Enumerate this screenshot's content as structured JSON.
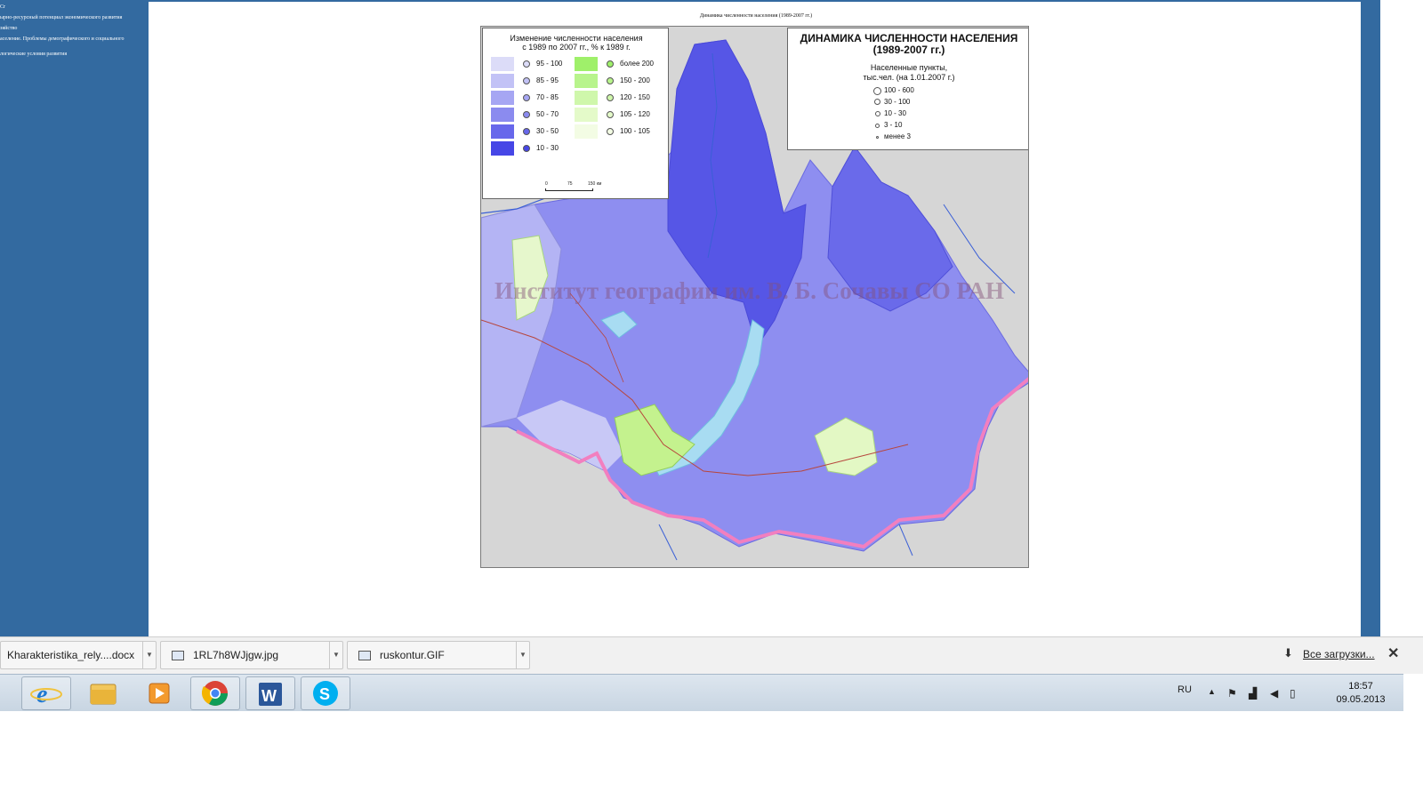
{
  "sidebar": {
    "links": [
      "Cr",
      "ырно-ресурсный потенциал экономического развития",
      "зяйство",
      "аселение. Проблемы демографического и социального",
      "логические условия развития"
    ]
  },
  "document": {
    "title": "Динамика численности населения (1989-2007 гг.)"
  },
  "map": {
    "legend_change": {
      "title_line1": "Изменение численности населения",
      "title_line2": "с 1989 по 2007 гг., % к 1989 г.",
      "decrease": [
        {
          "label": "95 - 100",
          "color": "#dcdcf8"
        },
        {
          "label": "85 - 95",
          "color": "#c2c2f6"
        },
        {
          "label": "70 - 85",
          "color": "#a6a6f3"
        },
        {
          "label": "50 - 70",
          "color": "#8b8bef"
        },
        {
          "label": "30 - 50",
          "color": "#6767eb"
        },
        {
          "label": "10 - 30",
          "color": "#4646e6"
        }
      ],
      "increase": [
        {
          "label": "более 200",
          "color": "#9ff06a"
        },
        {
          "label": "150 - 200",
          "color": "#b8f48c"
        },
        {
          "label": "120 - 150",
          "color": "#cff7ab"
        },
        {
          "label": "105 - 120",
          "color": "#e4fac9"
        },
        {
          "label": "100 - 105",
          "color": "#f3fce4"
        }
      ],
      "scale": {
        "ticks": [
          "0",
          "75",
          "150 км"
        ]
      }
    },
    "legend_settlements": {
      "title_line1": "ДИНАМИКА ЧИСЛЕННОСТИ НАСЕЛЕНИЯ",
      "title_line2": "(1989-2007 гг.)",
      "subtitle_line1": "Населенные пункты,",
      "subtitle_line2": "тыс.чел. (на 1.01.2007 г.)",
      "sizes": [
        "100 - 600",
        "30 - 100",
        "10 - 30",
        "3 - 10",
        "менее 3"
      ]
    },
    "watermark": "Институт географии им. В. Б. Сочавы СО РАН"
  },
  "downloads": {
    "items": [
      {
        "name": "Kharakteristika_rely....docx"
      },
      {
        "name": "1RL7h8WJjgw.jpg"
      },
      {
        "name": "ruskontur.GIF"
      }
    ],
    "show_all": "Все загрузки...",
    "close_symbol": "✕"
  },
  "taskbar": {
    "language": "RU",
    "time": "18:57",
    "date": "09.05.2013",
    "apps": [
      "start-orb",
      "internet-explorer",
      "file-explorer",
      "media-player",
      "chrome",
      "word",
      "skype"
    ]
  }
}
